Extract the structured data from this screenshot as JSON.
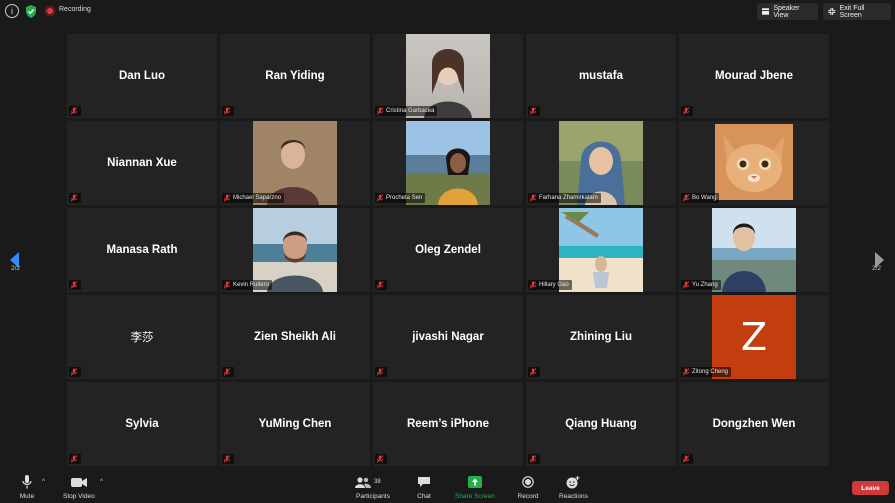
{
  "topbar": {
    "recording_label": "Recording",
    "speaker_view_label": "Speaker View",
    "exit_fullscreen_label": "Exit Full Screen"
  },
  "pagination": {
    "left": "2/2",
    "right": "2/2"
  },
  "tiles": [
    {
      "name": "Dan Luo",
      "video": false
    },
    {
      "name": "Ran Yiding",
      "video": false
    },
    {
      "name": "Cristina Garbacea",
      "video": true
    },
    {
      "name": "mustafa",
      "video": false
    },
    {
      "name": "Mourad Jbene",
      "video": false
    },
    {
      "name": "Niannan Xue",
      "video": false
    },
    {
      "name": "Michael Saparzno",
      "video": true
    },
    {
      "name": "Procheta Sen",
      "video": true
    },
    {
      "name": "Farhana Zhamirkalam",
      "video": true
    },
    {
      "name": "Bo Wang",
      "video": true
    },
    {
      "name": "Manasa Rath",
      "video": false
    },
    {
      "name": "Kevin Ruitero",
      "video": true
    },
    {
      "name": "Oleg Zendel",
      "video": false
    },
    {
      "name": "Hillary Gao",
      "video": true
    },
    {
      "name": "Yu Zhang",
      "video": true
    },
    {
      "name": "李莎",
      "video": false
    },
    {
      "name": "Zien Sheikh Ali",
      "video": false
    },
    {
      "name": "jivashi Nagar",
      "video": false
    },
    {
      "name": "Zhining Liu",
      "video": false
    },
    {
      "name": "Zitong Cheng",
      "video": true,
      "avatar_letter": "Z"
    },
    {
      "name": "Sylvia",
      "video": false
    },
    {
      "name": "YuMing Chen",
      "video": false
    },
    {
      "name": "Reem’s iPhone",
      "video": false
    },
    {
      "name": "Qiang Huang",
      "video": false
    },
    {
      "name": "Dongzhen Wen",
      "video": false
    }
  ],
  "toolbar": {
    "mute_label": "Mute",
    "stop_video_label": "Stop Video",
    "participants_label": "Participants",
    "participants_count": "38",
    "chat_label": "Chat",
    "share_screen_label": "Share Screen",
    "record_label": "Record",
    "reactions_label": "Reactions",
    "leave_label": "Leave"
  },
  "colors": {
    "background": "#1a1a1a",
    "tile": "#232323",
    "share_green": "#23b04a",
    "leave_red": "#d03a3a",
    "mute_red": "#e03b3b",
    "nav_blue": "#2d8cff",
    "avatar_orange": "#c43d0f"
  }
}
